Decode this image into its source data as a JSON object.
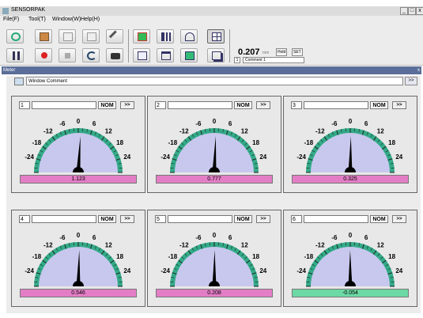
{
  "window": {
    "title": "SENSORPAK",
    "minimize": "_",
    "restore": "□",
    "close": "x"
  },
  "menu": [
    "File(F)",
    "Tool(T)",
    "Window(W)",
    "Help(H)"
  ],
  "toolbar": {
    "value": "0.207",
    "unit": "mm",
    "buttons": {
      "hold": "Hold",
      "set": "SET"
    },
    "comment_number": "1",
    "comment": "Comment 1"
  },
  "meter_panel": {
    "title": "Meter",
    "close": "x",
    "window_comment": "Window Comment",
    "expand_label": ">>"
  },
  "scale": {
    "labels": [
      "-24",
      "-18",
      "-12",
      "-6",
      "0",
      "6",
      "12",
      "18",
      "24"
    ],
    "min": -30,
    "max": 30
  },
  "meters": [
    {
      "number": "1",
      "nom_label": "NOM",
      "go_label": ">>",
      "value": "1.123",
      "value_num": 1.123,
      "status_color": "#e37ec6"
    },
    {
      "number": "2",
      "nom_label": "NOM",
      "go_label": ">>",
      "value": "0.777",
      "value_num": 0.777,
      "status_color": "#e37ec6"
    },
    {
      "number": "3",
      "nom_label": "NOM",
      "go_label": ">>",
      "value": "0.325",
      "value_num": 0.325,
      "status_color": "#e37ec6"
    },
    {
      "number": "4",
      "nom_label": "NOM",
      "go_label": ">>",
      "value": "0.546",
      "value_num": 0.546,
      "status_color": "#e37ec6"
    },
    {
      "number": "5",
      "nom_label": "NOM",
      "go_label": ">>",
      "value": "0.208",
      "value_num": 0.208,
      "status_color": "#e37ec6"
    },
    {
      "number": "6",
      "nom_label": "NOM",
      "go_label": ">>",
      "value": "-0.054",
      "value_num": -0.054,
      "status_color": "#6dd9a4"
    }
  ],
  "colors": {
    "dial_face": "#c8c8ee",
    "dial_band": "#33aa88",
    "needle": "#000000"
  }
}
